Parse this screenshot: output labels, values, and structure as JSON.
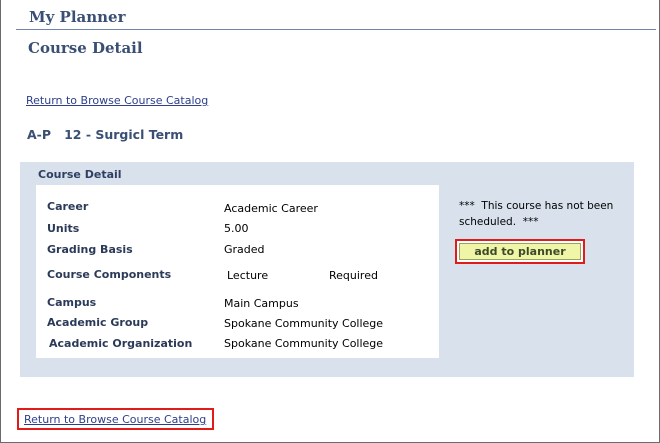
{
  "header": {
    "title": "My Planner"
  },
  "page": {
    "title": "Course Detail"
  },
  "links": {
    "return_top": "Return to Browse Course Catalog",
    "return_bottom": "Return to Browse Course Catalog"
  },
  "course": {
    "heading": "A-P   12 - Surgicl Term"
  },
  "detail": {
    "panel_title": "Course Detail",
    "career": {
      "label": "Career",
      "value": "Academic Career"
    },
    "units": {
      "label": "Units",
      "value": "5.00"
    },
    "grading": {
      "label": "Grading Basis",
      "value": "Graded"
    },
    "components": {
      "label": "Course Components",
      "value": "Lecture",
      "status": "Required"
    },
    "campus": {
      "label": "Campus",
      "value": "Main Campus"
    },
    "group": {
      "label": "Academic Group",
      "value": "Spokane Community College"
    },
    "organization": {
      "label": "Academic Organization",
      "value": "Spokane Community College"
    }
  },
  "notice": {
    "line1": "***  This course has not been",
    "line2": "scheduled.  ***"
  },
  "actions": {
    "add_to_planner": "add to planner"
  },
  "colors": {
    "highlight": "#e11a1a",
    "title_blue": "#3a4f74",
    "panel_bg": "#d8e1ec",
    "button_bg": "#f0f5a8"
  }
}
